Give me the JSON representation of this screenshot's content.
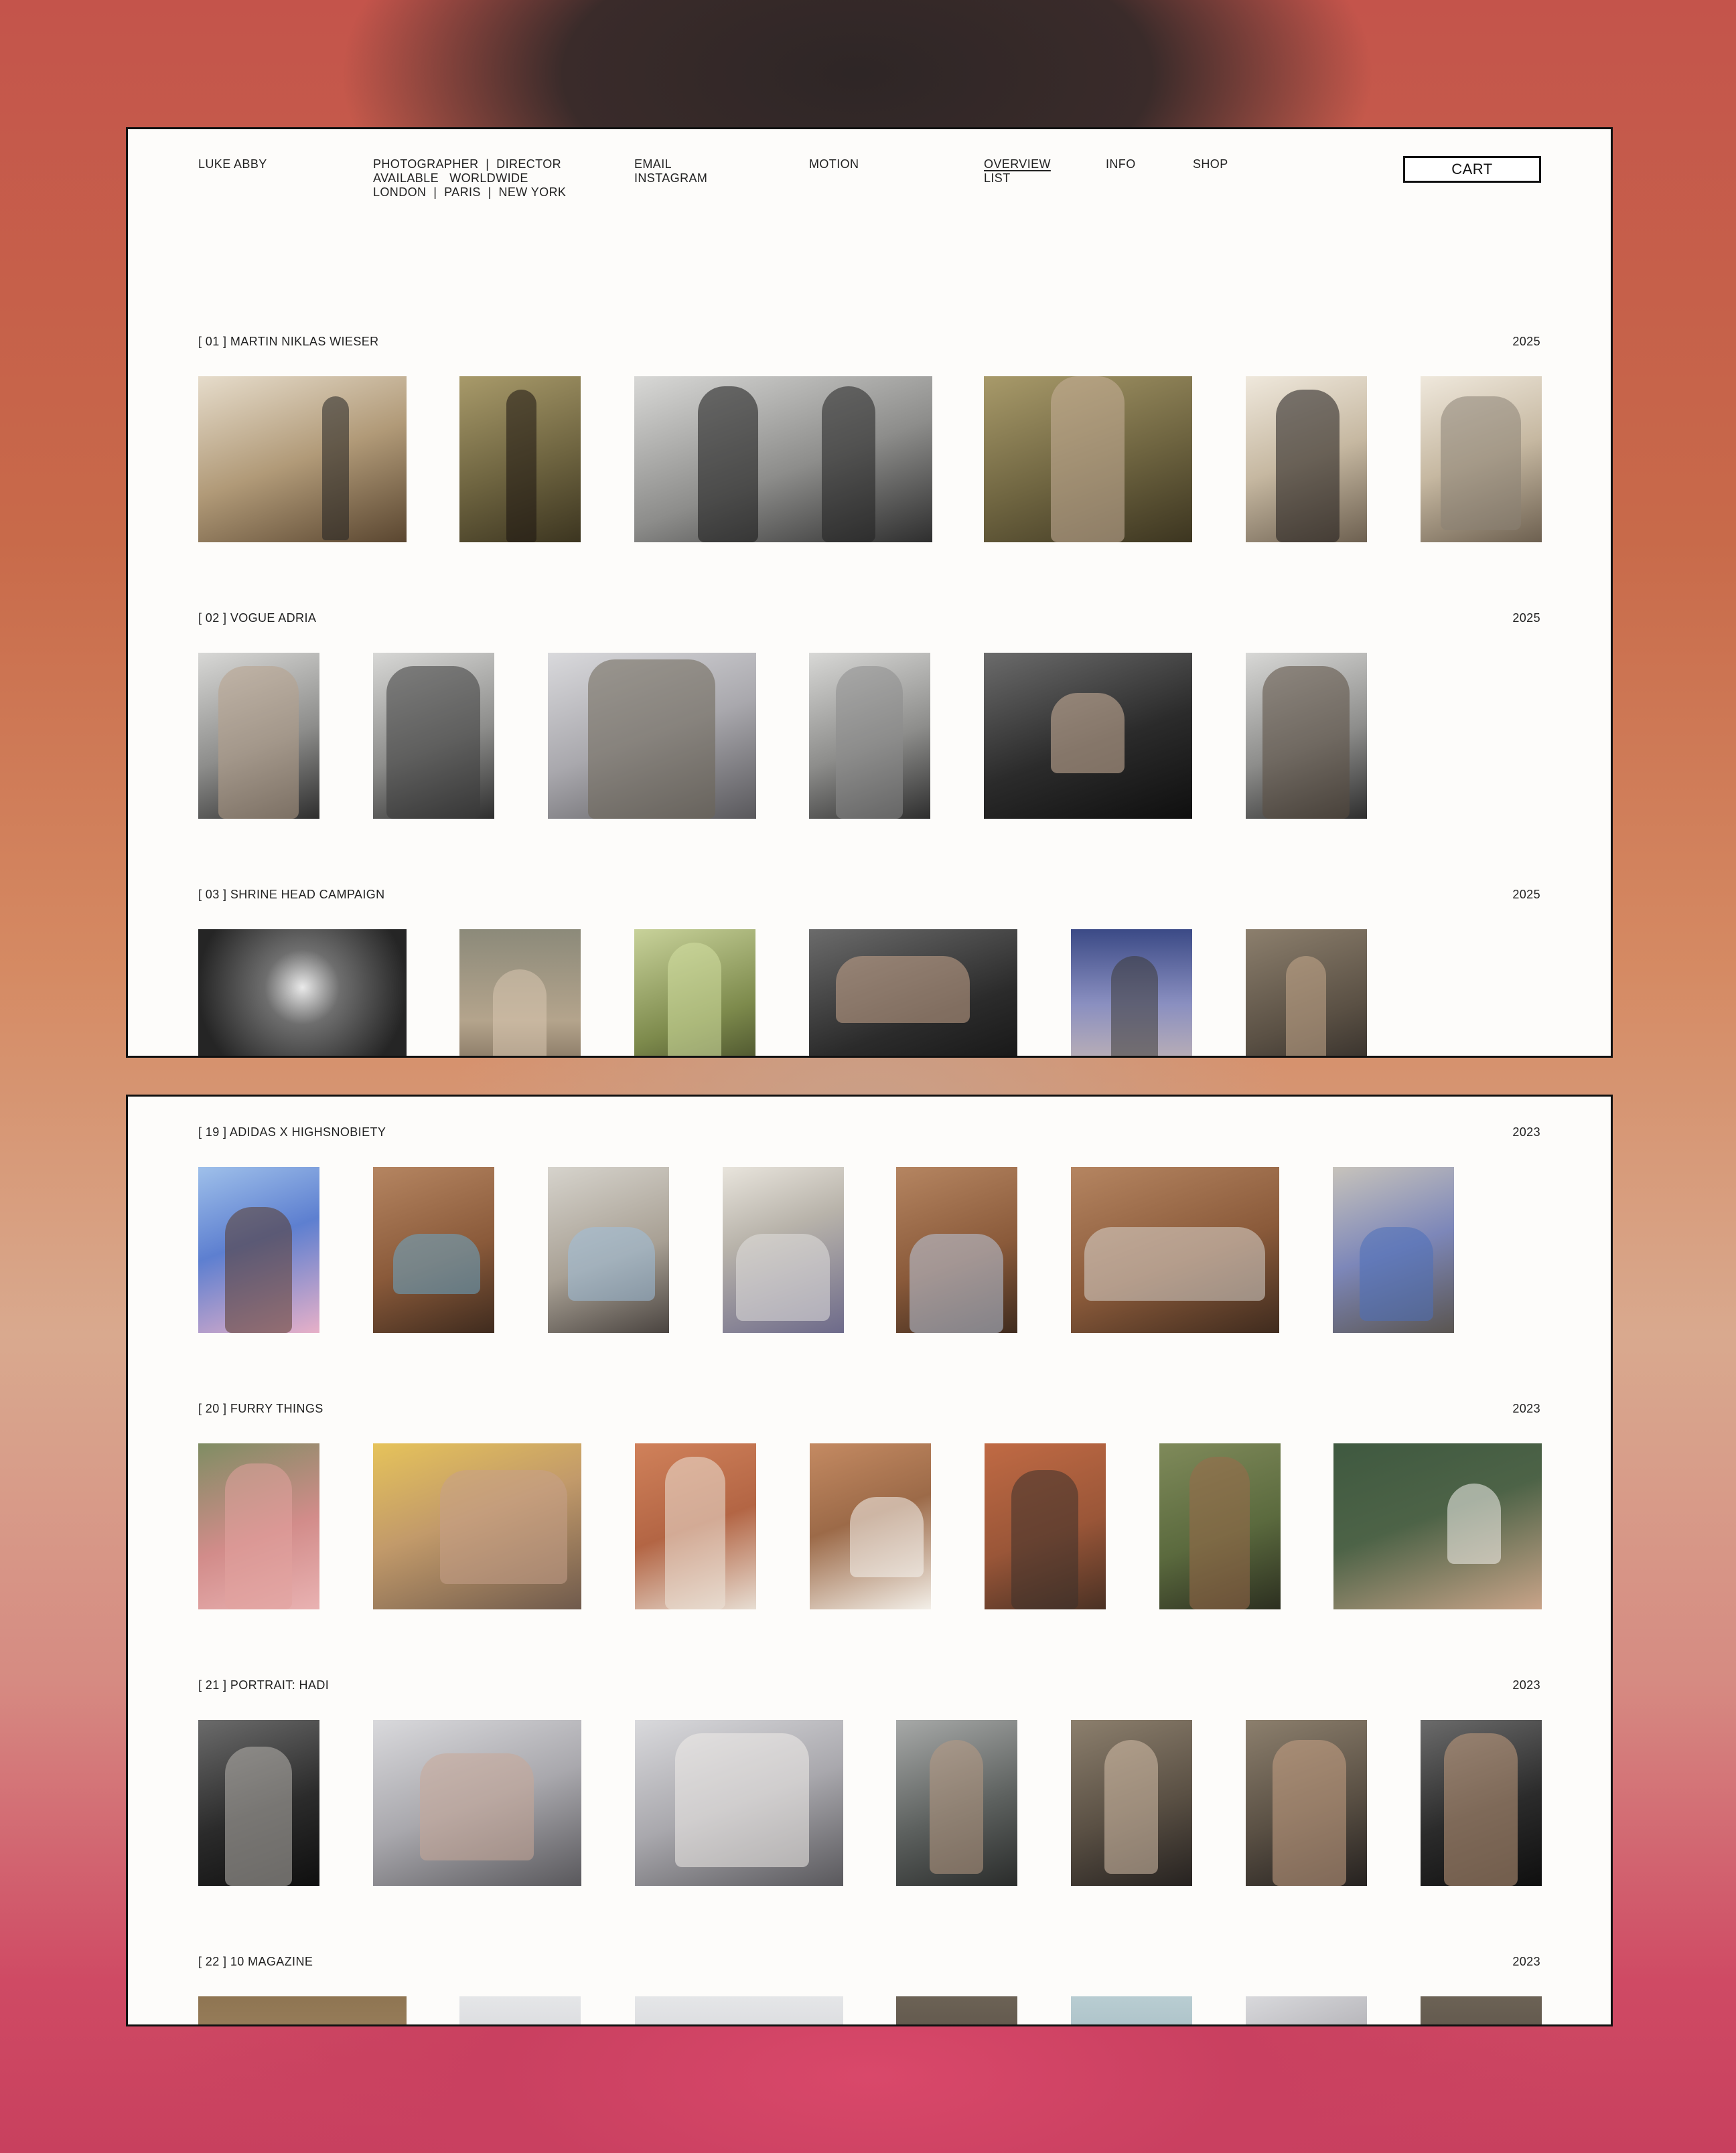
{
  "brand": "LUKE ABBY",
  "tagline": [
    "PHOTOGRAPHER  |  DIRECTOR",
    "AVAILABLE   WORLDWIDE",
    "LONDON  |  PARIS  |  NEW YORK"
  ],
  "contact": [
    "EMAIL",
    "INSTAGRAM"
  ],
  "nav": {
    "motion": "MOTION",
    "overview": "OVERVIEW",
    "list": "LIST",
    "info": "INFO",
    "shop": "SHOP",
    "cart": "CART"
  },
  "projects_top": [
    {
      "title": "[ 01 ] MARTIN NIKLAS WIESER",
      "year": "2025"
    },
    {
      "title": "[ 02 ] VOGUE ADRIA",
      "year": "2025"
    },
    {
      "title": "[ 03 ] SHRINE HEAD CAMPAIGN",
      "year": "2025"
    }
  ],
  "projects_bottom": [
    {
      "title": "[ 19 ] ADIDAS X HIGHSNOBIETY",
      "year": "2023"
    },
    {
      "title": "[ 20 ] FURRY THINGS",
      "year": "2023"
    },
    {
      "title": "[ 21 ] PORTRAIT: HADI",
      "year": "2023"
    },
    {
      "title": "[ 22 ] 10 MAGAZINE",
      "year": "2023"
    }
  ]
}
